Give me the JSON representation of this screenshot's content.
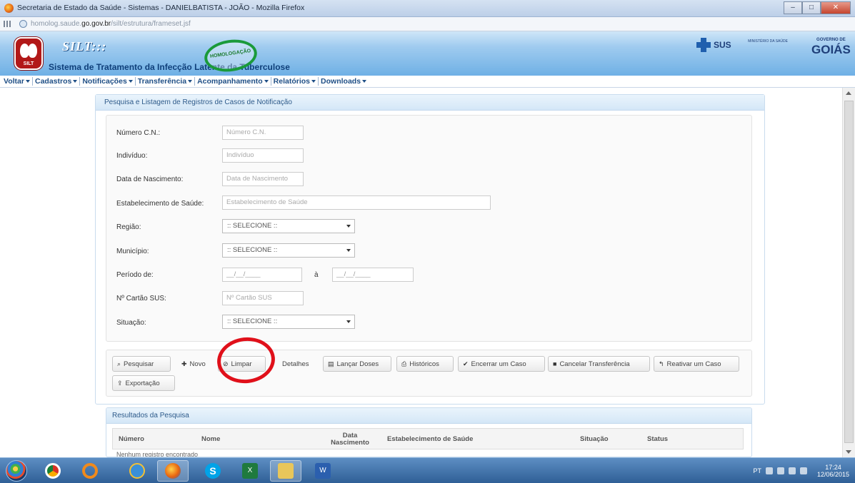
{
  "window": {
    "title": "Secretaria de Estado da Saúde - Sistemas - DANIELBATISTA - JOÃO - Mozilla Firefox",
    "buttons": [
      "–",
      "□",
      "✕"
    ]
  },
  "address": {
    "url_prefix": "homolog.saude.",
    "url_domain": "go.gov.br",
    "url_path": "/silt/estrutura/frameset.jsf"
  },
  "header": {
    "logo_text": "SILT",
    "app_name": "SILT:::",
    "subtitle": "Sistema de Tratamento da Infecção Latente da Tuberculose",
    "stamp_text": "HOMOLOGAÇÃO",
    "sus_label": "SUS",
    "ministerio_label": "MINISTÉRIO DA SAÚDE",
    "goias_small": "GOVERNO DE",
    "goias_big": "GOIÁS"
  },
  "nav": {
    "items": [
      {
        "label": "Voltar"
      },
      {
        "label": "Cadastros"
      },
      {
        "label": "Notificações"
      },
      {
        "label": "Transferência"
      },
      {
        "label": "Acompanhamento"
      },
      {
        "label": "Relatórios"
      },
      {
        "label": "Downloads"
      }
    ]
  },
  "search_panel": {
    "title": "Pesquisa e Listagem de Registros de Casos de Notificação",
    "fields": {
      "numero_cn": {
        "label": "Número C.N.:",
        "placeholder": "Número C.N."
      },
      "individuo": {
        "label": "Indivíduo:",
        "placeholder": "Indivíduo"
      },
      "nascimento": {
        "label": "Data de Nascimento:",
        "placeholder": "Data de Nascimento"
      },
      "estabelecimento": {
        "label": "Estabelecimento de Saúde:",
        "placeholder": "Estabelecimento de Saúde"
      },
      "regiao": {
        "label": "Região:",
        "value": ":: SELECIONE ::"
      },
      "municipio": {
        "label": "Município:",
        "value": ":: SELECIONE ::"
      },
      "periodo": {
        "label": "Período de:",
        "from": "__/__/____",
        "to_label": "à",
        "to": "__/__/____"
      },
      "cartao_sus": {
        "label": "Nº Cartão SUS:",
        "placeholder": "Nº Cartão SUS"
      },
      "situacao": {
        "label": "Situação:",
        "value": ":: SELECIONE ::"
      }
    }
  },
  "actions": {
    "pesquisar": "Pesquisar",
    "novo": "Novo",
    "limpar": "Limpar",
    "detalhes": "Detalhes",
    "lancar_doses": "Lançar Doses",
    "historicos": "Históricos",
    "encerrar": "Encerrar um Caso",
    "cancelar_transferencia": "Cancelar Transferência",
    "reativar": "Reativar um Caso",
    "exportacao": "Exportação"
  },
  "results": {
    "title": "Resultados da Pesquisa",
    "columns": [
      "Número",
      "Nome",
      "Data Nascimento",
      "Estabelecimento de Saúde",
      "Situação",
      "Status"
    ],
    "empty_message": "Nenhum registro encontrado"
  },
  "annotation": {
    "color": "#e0101a"
  },
  "taskbar": {
    "language": "PT",
    "clock_time": "17:24",
    "clock_date": "12/06/2015"
  },
  "colors": {
    "header_blue": "#6fb0e5",
    "nav_text": "#1f4f86",
    "panel_head": "#d4e7f7",
    "taskbar": "#2f5f96"
  }
}
